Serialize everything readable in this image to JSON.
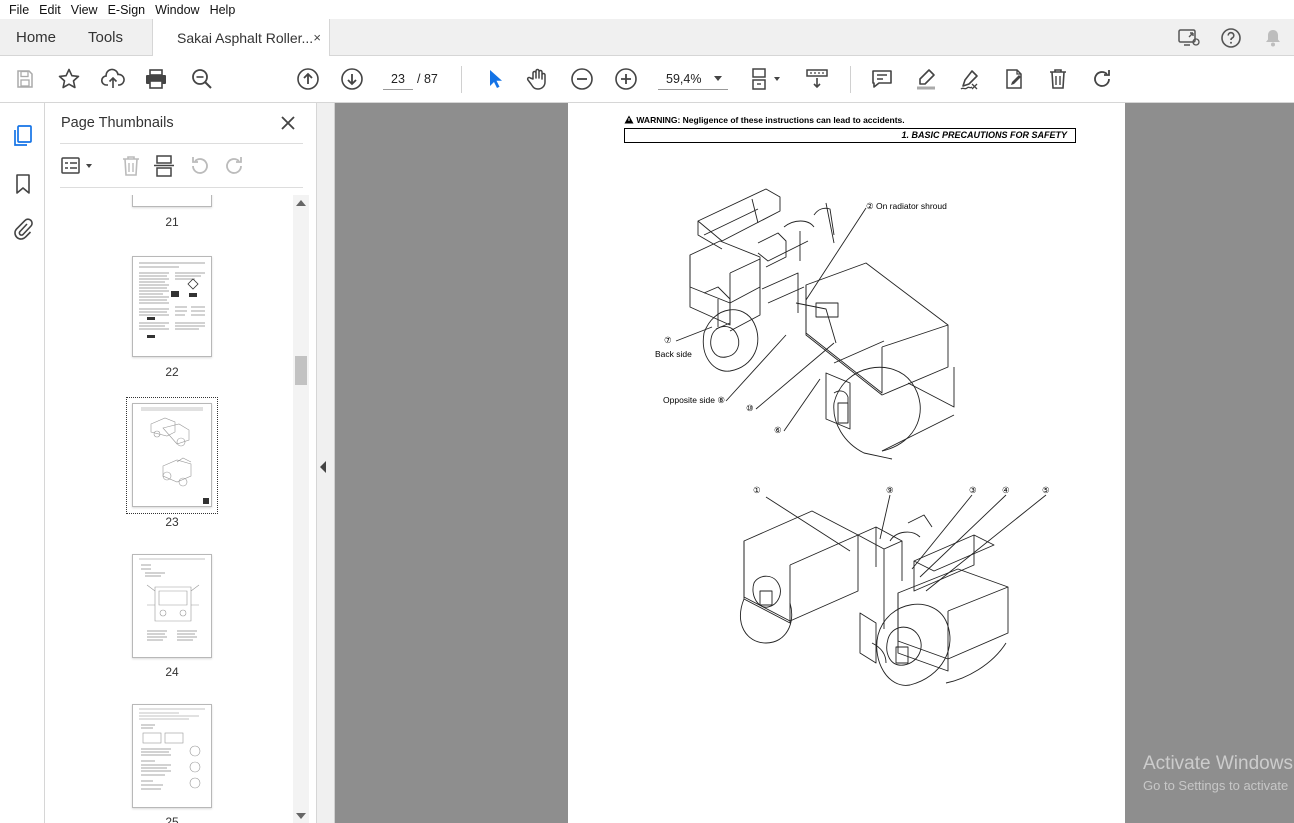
{
  "menu": [
    "File",
    "Edit",
    "View",
    "E-Sign",
    "Window",
    "Help"
  ],
  "tabs": {
    "home": "Home",
    "tools": "Tools",
    "document": "Sakai Asphalt Roller...",
    "close": "×"
  },
  "toolbar": {
    "current_page": "23",
    "total_pages": "/ 87",
    "zoom": "59,4%"
  },
  "panel": {
    "title": "Page Thumbnails",
    "thumbnails": [
      {
        "label": "21"
      },
      {
        "label": "22"
      },
      {
        "label": "23",
        "selected": true
      },
      {
        "label": "24"
      },
      {
        "label": "25"
      }
    ]
  },
  "document": {
    "warning": "WARNING: Negligence of these instructions can lead to accidents.",
    "section": "1.  BASIC PRECAUTIONS FOR SAFETY",
    "callouts": {
      "c2": "② On radiator shroud",
      "c7": "⑦",
      "back_side": "Back side",
      "opposite_side": "Opposite side  ⑧",
      "c10": "⑩",
      "c6": "⑥",
      "c1": "①",
      "c9": "⑨",
      "c3": "③",
      "c4": "④",
      "c5": "⑤"
    }
  },
  "watermark": {
    "line1": "Activate Windows",
    "line2": "Go to Settings to activate"
  },
  "colors": {
    "accent": "#1473e6",
    "doc_bg": "#8e8e8e",
    "tabbar_bg": "#f0f0f0"
  }
}
